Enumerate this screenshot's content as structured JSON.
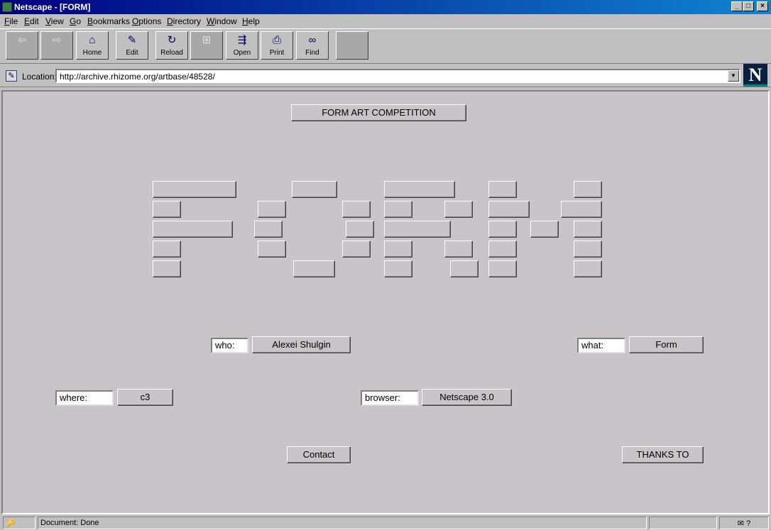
{
  "window": {
    "title": "Netscape - [FORM]",
    "min": "_",
    "max": "□",
    "close": "×"
  },
  "menu": [
    "File",
    "Edit",
    "View",
    "Go",
    "Bookmarks",
    "Options",
    "Directory",
    "Window",
    "Help"
  ],
  "toolbar": {
    "back": "Back",
    "forward": "Forward",
    "home": "Home",
    "edit": "Edit",
    "reload": "Reload",
    "open": "Open",
    "print": "Print",
    "find": "Find"
  },
  "location": {
    "label": "Location:",
    "url": "http://archive.rhizome.org/artbase/48528/"
  },
  "logo": "N",
  "page": {
    "competition_button": "FORM ART COMPETITION",
    "who_label": "who:",
    "who_value": "Alexei Shulgin",
    "what_label": "what:",
    "what_value": "Form",
    "where_label": "where:",
    "where_value": "c3",
    "browser_label": "browser:",
    "browser_value": "Netscape 3.0",
    "contact": "Contact",
    "thanks": "THANKS TO"
  },
  "status": {
    "text": "Document: Done"
  }
}
